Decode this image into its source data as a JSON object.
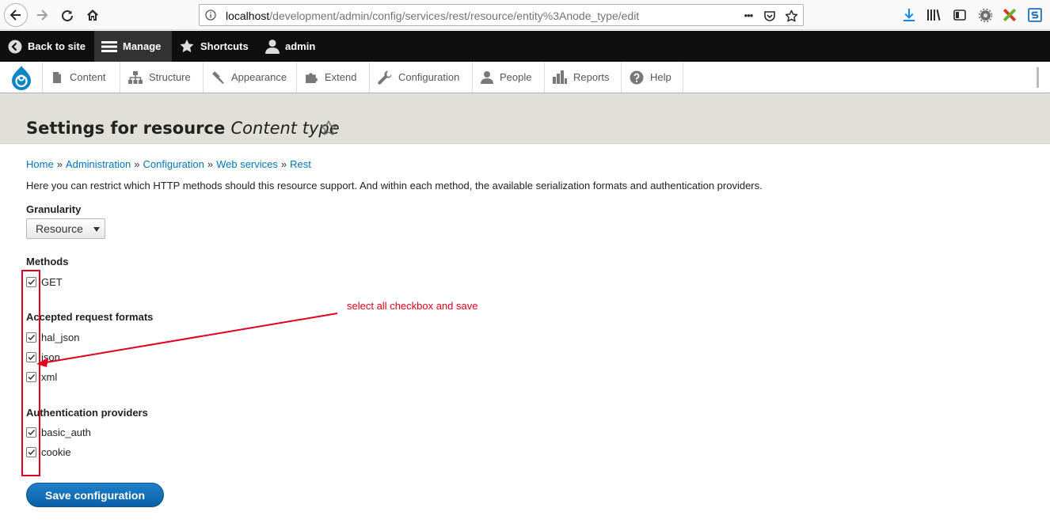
{
  "browser": {
    "url_prefix": "localhost",
    "url_rest": "/development/admin/config/services/rest/resource/entity%3Anode_type/edit",
    "more_label": "•••"
  },
  "toolbar": {
    "back_to_site": "Back to site",
    "manage": "Manage",
    "shortcuts": "Shortcuts",
    "user": "admin"
  },
  "tray": {
    "items": [
      {
        "label": "Content",
        "icon": "page-icon"
      },
      {
        "label": "Structure",
        "icon": "sitemap-icon"
      },
      {
        "label": "Appearance",
        "icon": "paintbrush-icon"
      },
      {
        "label": "Extend",
        "icon": "puzzle-icon"
      },
      {
        "label": "Configuration",
        "icon": "wrench-icon"
      },
      {
        "label": "People",
        "icon": "person-icon"
      },
      {
        "label": "Reports",
        "icon": "bar-chart-icon"
      },
      {
        "label": "Help",
        "icon": "help-icon"
      }
    ]
  },
  "page": {
    "title_prefix": "Settings for resource",
    "title_entity": "Content type",
    "breadcrumb": [
      "Home",
      "Administration",
      "Configuration",
      "Web services",
      "Rest"
    ],
    "breadcrumb_sep": "»",
    "description": "Here you can restrict which HTTP methods should this resource support. And within each method, the available serialization formats and authentication providers."
  },
  "form": {
    "granularity_label": "Granularity",
    "granularity_value": "Resource",
    "methods_label": "Methods",
    "methods": [
      {
        "label": "GET",
        "checked": true
      }
    ],
    "formats_label": "Accepted request formats",
    "formats": [
      {
        "label": "hal_json",
        "checked": true
      },
      {
        "label": "json",
        "checked": true
      },
      {
        "label": "xml",
        "checked": true
      }
    ],
    "auth_label": "Authentication providers",
    "auth": [
      {
        "label": "basic_auth",
        "checked": true
      },
      {
        "label": "cookie",
        "checked": true
      }
    ],
    "save_label": "Save configuration"
  },
  "annotation": {
    "text": "select all checkbox and save",
    "color": "#e0001b"
  },
  "colors": {
    "link": "#0074bd",
    "toolbar_bg": "#0f0f0f",
    "header_bg": "#e0e0d8",
    "button_bg": "#0a5fa6"
  }
}
